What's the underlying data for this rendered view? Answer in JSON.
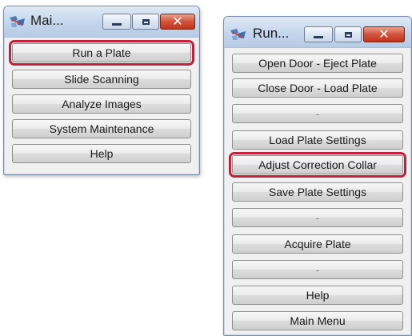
{
  "main_window": {
    "title": "Mai...",
    "buttons": [
      "Run a Plate",
      "Slide Scanning",
      "Analyze Images",
      "System Maintenance",
      "Help"
    ],
    "highlighted_button": "Run a Plate"
  },
  "run_window": {
    "title": "Run...",
    "buttons": [
      "Open Door - Eject Plate",
      "Close Door - Load Plate",
      "-",
      "Load Plate Settings",
      "Adjust Correction Collar",
      "Save Plate Settings",
      "-",
      "Acquire Plate",
      "-",
      "Help",
      "Main Menu"
    ],
    "highlighted_button": "Adjust Correction Collar"
  },
  "icons": {
    "app": "app-icon",
    "minimize": "minimize-icon",
    "maximize": "maximize-icon",
    "close": "close-icon"
  },
  "colors": {
    "highlight": "#c4203c",
    "close_button": "#c3321b",
    "titlebar": "#c4d6ec"
  }
}
